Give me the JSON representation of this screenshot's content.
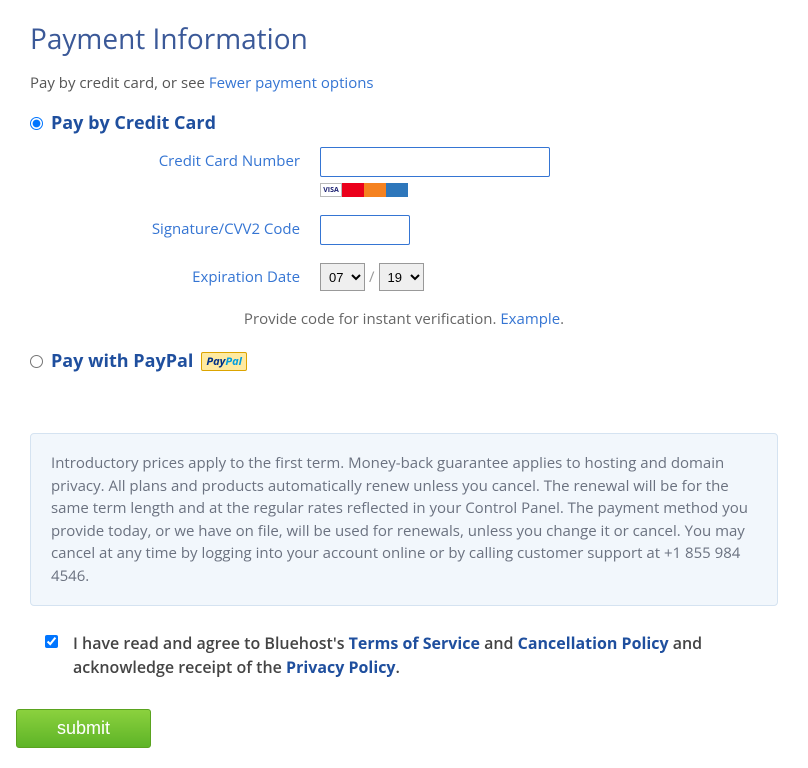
{
  "title": "Payment Information",
  "sub_prefix": "Pay by credit card, or see ",
  "sub_link": "Fewer payment options",
  "cc": {
    "option_label": "Pay by Credit Card",
    "num_label": "Credit Card Number",
    "cvv_label": "Signature/CVV2 Code",
    "exp_label": "Expiration Date",
    "month": "07",
    "year": "19"
  },
  "verify_text": "Provide code for instant verification. ",
  "verify_link": "Example",
  "paypal_label": "Pay with PayPal",
  "terms_text": "Introductory prices apply to the first term. Money-back guarantee applies to hosting and domain privacy. All plans and products automatically renew unless you cancel. The renewal will be for the same term length and at the regular rates reflected in your Control Panel. The payment method you provide today, or we have on file, will be used for renewals, unless you change it or cancel. You may cancel at any time by logging into your account online or by calling customer support at +1 855 984 4546.",
  "agree": {
    "t1": "I have read and agree to Bluehost's ",
    "tos": "Terms of Service",
    "t2": " and ",
    "cancel": "Cancellation Policy",
    "t3": " and acknowledge receipt of the ",
    "privacy": "Privacy Policy",
    "t4": "."
  },
  "submit_label": "submit"
}
